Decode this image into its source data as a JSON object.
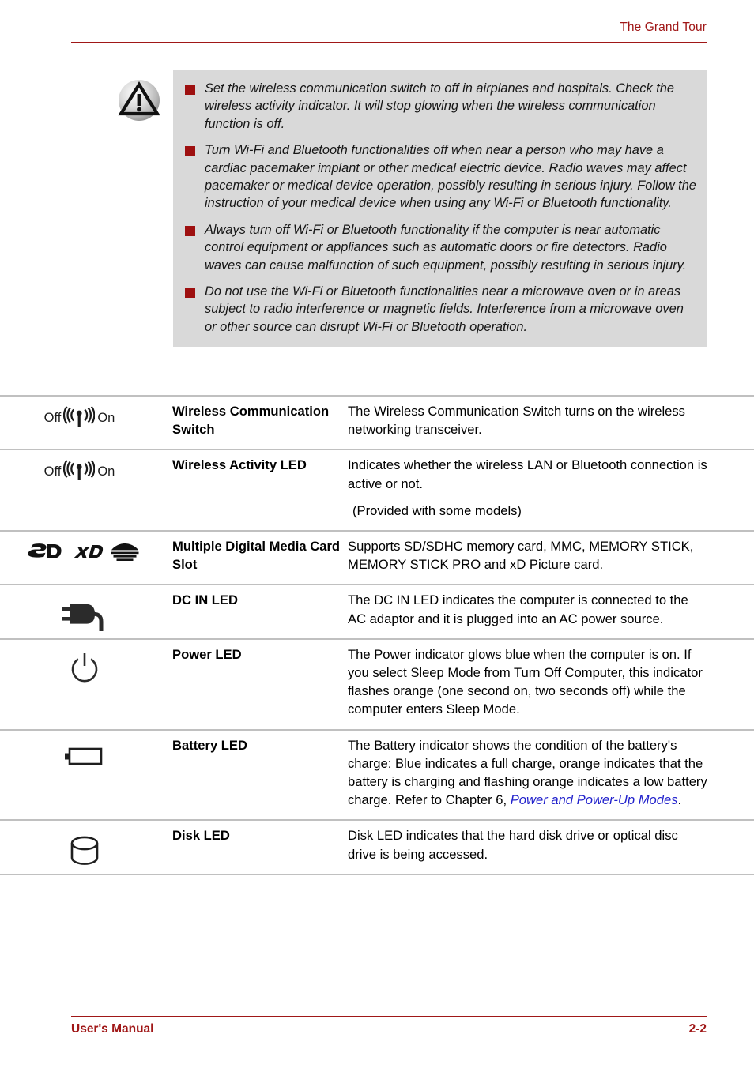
{
  "header": {
    "title": "The Grand Tour",
    "rule_color": "#A01717"
  },
  "caution": {
    "icon_name": "warning-triangle-icon",
    "background_color": "#d9d9d9",
    "bullet_color": "#9E1010",
    "items": [
      "Set the wireless communication switch to off in airplanes and hospitals. Check the wireless activity indicator. It will stop glowing when the wireless communication function is off.",
      "Turn Wi-Fi and Bluetooth functionalities off when near a person who may have a cardiac pacemaker implant or other medical electric device. Radio waves may affect pacemaker or medical device operation, possibly resulting in serious injury. Follow the instruction of your medical device when using any Wi-Fi or Bluetooth functionality.",
      "Always turn off Wi-Fi or Bluetooth functionality if the computer is near automatic control equipment or appliances such as automatic doors or fire detectors. Radio waves can cause malfunction of such equipment, possibly resulting in serious injury.",
      "Do not use the Wi-Fi or Bluetooth functionalities near a microwave oven or in areas subject to radio interference or magnetic fields. Interference from a microwave oven or other source can disrupt Wi-Fi or Bluetooth operation."
    ]
  },
  "table": {
    "rows": [
      {
        "icon": "wireless-switch-icon",
        "icon_off_label": "Off",
        "icon_on_label": "On",
        "name": "Wireless Communication Switch",
        "description": "The Wireless Communication Switch turns on the wireless networking transceiver.",
        "note": ""
      },
      {
        "icon": "wireless-activity-icon",
        "icon_off_label": "Off",
        "icon_on_label": "On",
        "name": "Wireless Activity LED",
        "description": "Indicates whether the wireless LAN or Bluetooth connection is active or not.",
        "note": "(Provided with some models)"
      },
      {
        "icon": "media-card-icons",
        "name": "Multiple Digital Media Card Slot",
        "description": "Supports SD/SDHC memory card, MMC, MEMORY STICK, MEMORY STICK PRO and xD Picture card.",
        "note": ""
      },
      {
        "icon": "dc-in-plug-icon",
        "name": "DC IN LED",
        "description": "The DC IN LED indicates the computer is connected to the AC adaptor and it is plugged into an AC power source.",
        "note": ""
      },
      {
        "icon": "power-symbol-icon",
        "name": "Power LED",
        "description": "The Power indicator glows blue when the computer is on. If you select Sleep Mode from Turn Off Computer, this indicator flashes orange (one second on, two seconds off) while the computer enters Sleep Mode.",
        "note": ""
      },
      {
        "icon": "battery-icon",
        "name": "Battery LED",
        "description_before": "The Battery indicator shows the condition of the battery's charge: Blue indicates a full charge, orange indicates that the battery is charging and flashing orange indicates a low battery charge. Refer to Chapter 6, ",
        "xref": "Power and Power-Up Modes",
        "description_after": ".",
        "note": ""
      },
      {
        "icon": "disk-cylinder-icon",
        "name": "Disk LED",
        "description": "Disk LED indicates that the hard disk drive or optical disc drive is being accessed.",
        "note": ""
      }
    ],
    "card_icon_labels": [
      "SD",
      "xD",
      "memory-stick"
    ],
    "xref_color": "#2222CC",
    "rule_color": "#c0c0c0"
  },
  "footer": {
    "left": "User's Manual",
    "page": "2-2",
    "rule_color": "#A01717"
  }
}
